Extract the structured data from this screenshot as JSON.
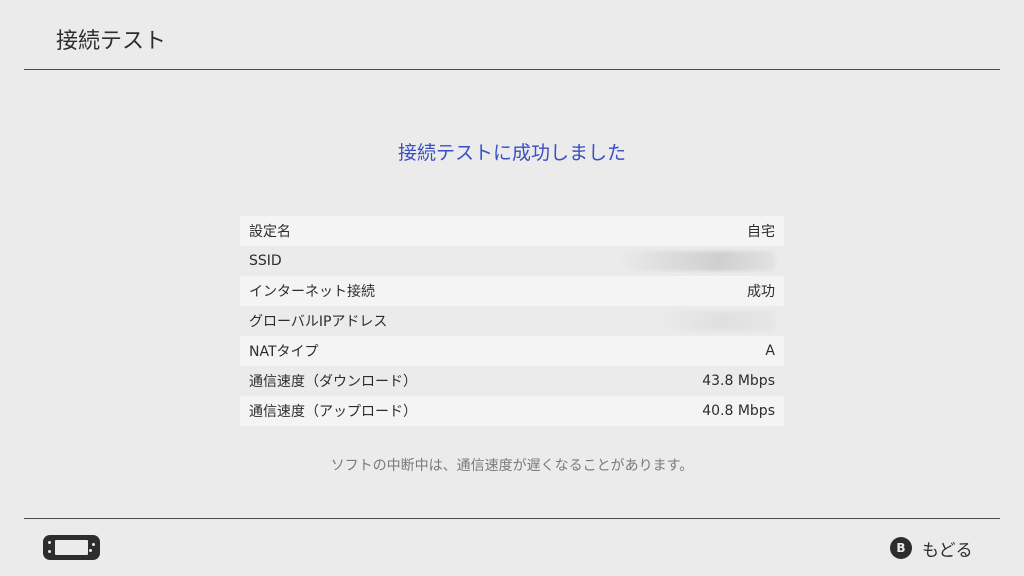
{
  "header": {
    "title": "接続テスト"
  },
  "result": {
    "message": "接続テストに成功しました"
  },
  "info_rows": [
    {
      "label": "設定名",
      "value": "自宅"
    },
    {
      "label": "SSID",
      "value": ""
    },
    {
      "label": "インターネット接続",
      "value": "成功"
    },
    {
      "label": "グローバルIPアドレス",
      "value": ""
    },
    {
      "label": "NATタイプ",
      "value": "A"
    },
    {
      "label": "通信速度（ダウンロード）",
      "value": "43.8 Mbps"
    },
    {
      "label": "通信速度（アップロード）",
      "value": "40.8 Mbps"
    }
  ],
  "note": "ソフトの中断中は、通信速度が遅くなることがあります。",
  "footer": {
    "console_icon": "handheld-console-icon",
    "back_button": {
      "glyph": "B",
      "label": "もどる"
    }
  },
  "colors": {
    "background": "#ebebeb",
    "accent_text": "#3a4fc4",
    "row_shade": "#f4f4f4",
    "note_text": "#7a7a7a"
  }
}
